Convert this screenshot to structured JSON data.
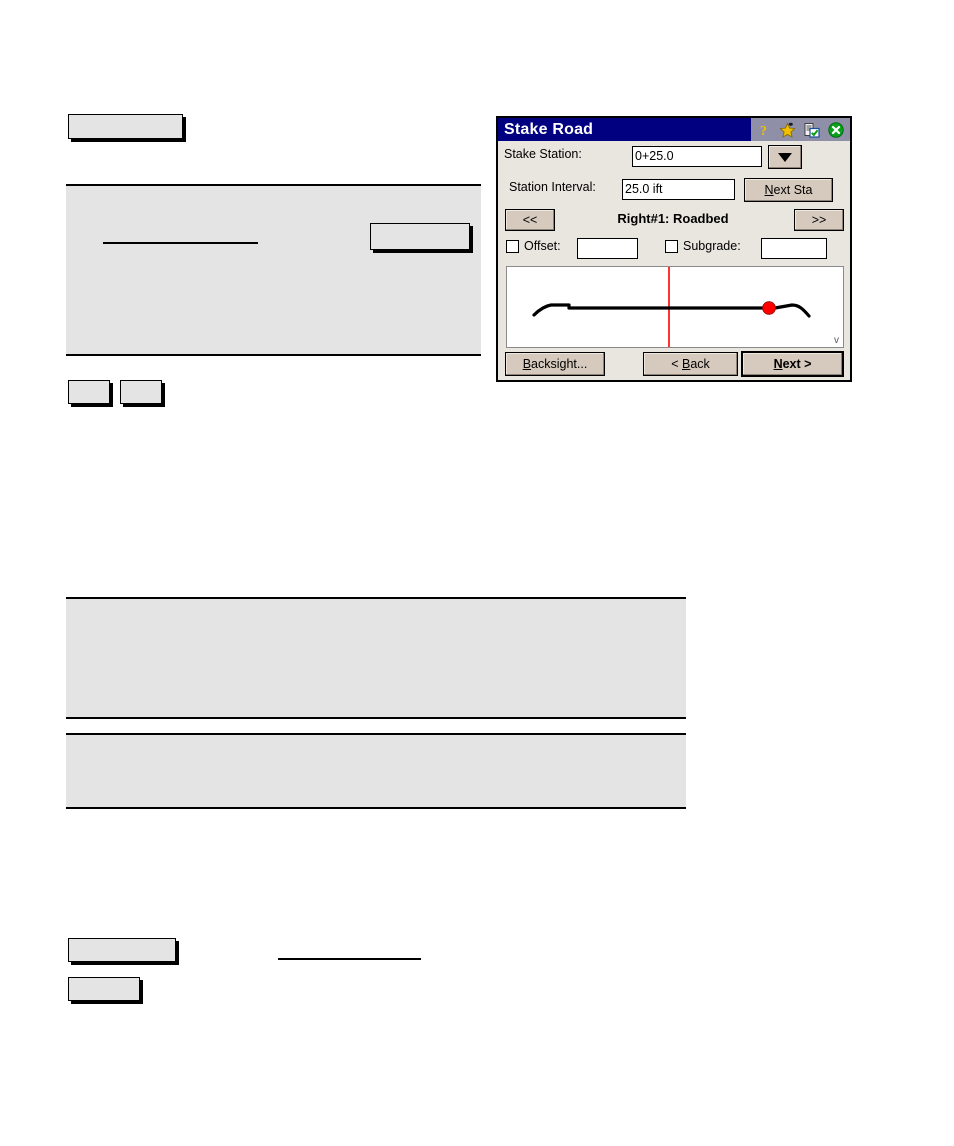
{
  "page": {
    "background_color": "#ffffff",
    "placeholder_fill": "#e4e4e4",
    "placeholder_border": "#000000"
  },
  "dialog": {
    "title": "Stake Road",
    "title_bar_color": "#000080",
    "title_text_color": "#ffffff",
    "dialog_face_color": "#e9e6e0",
    "button_face_color": "#d6c9bd",
    "title_icons": [
      {
        "name": "help-icon",
        "glyph": "?",
        "color": "#f2c200"
      },
      {
        "name": "star-icon",
        "glyph": "★",
        "color": "#f2c200"
      },
      {
        "name": "clipboard-check-icon",
        "glyph": "Ὕ2",
        "color": "#1a5fb4"
      },
      {
        "name": "close-icon",
        "glyph": "✕",
        "color": "#0a9c18"
      }
    ],
    "fields": {
      "stake_station_label": "Stake Station:",
      "stake_station_value": "0+25.0",
      "station_interval_label": "Station Interval:",
      "station_interval_value": "25.0 ift"
    },
    "buttons": {
      "next_sta": "Next Sta",
      "next_sta_accel": "N",
      "prev_arrow": "<<",
      "next_arrow": ">>",
      "backsight": "Backsight...",
      "backsight_accel": "B",
      "back": "< Back",
      "back_accel": "B",
      "next": "Next >",
      "next_accel": "N"
    },
    "section_title": "Right#1:  Roadbed",
    "checkboxes": [
      {
        "label": "Offset:",
        "checked": false,
        "value": ""
      },
      {
        "label": "Subgrade:",
        "checked": false,
        "value": ""
      }
    ],
    "cross_section": {
      "centerline_color": "#ff0000",
      "profile_color": "#000000",
      "stake_point_color": "#ff0000",
      "corner_marker": "v"
    }
  },
  "document_blocks": {
    "top_button_box": "",
    "mid_band": "",
    "mid_inner_box": "",
    "mid_rule": "",
    "small_box_1": "",
    "small_box_2": "",
    "band_large": "",
    "band_small": "",
    "bottom_box_1": "",
    "bottom_box_2": "",
    "bottom_rule": ""
  }
}
